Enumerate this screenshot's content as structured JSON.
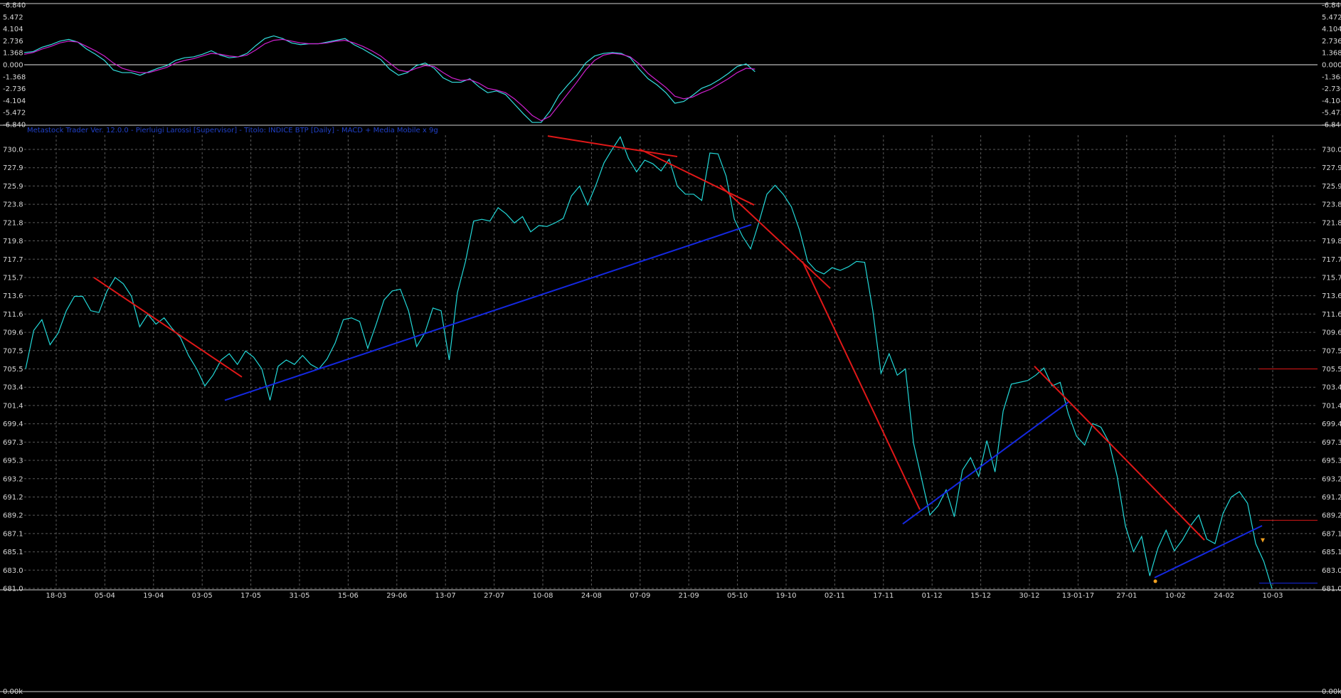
{
  "header": {
    "title": "Metastock Trader   Ver. 12.0.0  -  Pierluigi Larossi  [Supervisor]  -  Titolo: INDICE BTP  [Daily]  -  MACD + Media Mobile x 9g"
  },
  "colors": {
    "background": "#000000",
    "price": "#22d8d8",
    "macd": "#33e0e0",
    "signal": "#d020d0",
    "trend_down": "#e01818",
    "trend_up": "#1428e0",
    "grid": "#5a5a5a",
    "axis_text": "#d8d8d8",
    "highlight_date": "#e02020",
    "marker": "#f0a020"
  },
  "chart_data": [
    {
      "type": "line",
      "panel": "macd",
      "series": [],
      "x": [
        0,
        5,
        10,
        15,
        20,
        25,
        30,
        35,
        40,
        45,
        50,
        55,
        60,
        65,
        70,
        75,
        80,
        85,
        90,
        95,
        100,
        105,
        110,
        115,
        120,
        125,
        130,
        135,
        140,
        145,
        150,
        155,
        160,
        165,
        170,
        175,
        180,
        185,
        190,
        195,
        200,
        205,
        210,
        215,
        220,
        225,
        230,
        235,
        240,
        245,
        250,
        255,
        260,
        265,
        270,
        275,
        280,
        285,
        290,
        295,
        300,
        305,
        310,
        315,
        320,
        325,
        330,
        335,
        340,
        345,
        350,
        355,
        360,
        365,
        370,
        375,
        380,
        385,
        390,
        395,
        400,
        405,
        410,
        415,
        420,
        425,
        430,
        435,
        440,
        445,
        450,
        455,
        460,
        465,
        470,
        475,
        480,
        485,
        490,
        495,
        500,
        505,
        510,
        515,
        520,
        525,
        530,
        535,
        540,
        545,
        550,
        555,
        560,
        565,
        570,
        575,
        580,
        585,
        590,
        595,
        600,
        605,
        610,
        615,
        620,
        625,
        630,
        635,
        640,
        645,
        650,
        655,
        660,
        665,
        670,
        675,
        680,
        685,
        690,
        695,
        700
      ],
      "values": [
        {
          "name": "MACD",
          "y": [
            1.4,
            1.5,
            2.0,
            2.3,
            2.7,
            2.9,
            2.6,
            1.8,
            1.2,
            0.5,
            -0.6,
            -0.9,
            -0.9,
            -1.2,
            -0.8,
            -0.4,
            -0.1,
            0.5,
            0.8,
            0.9,
            1.2,
            1.6,
            1.1,
            0.8,
            0.9,
            1.3,
            2.2,
            3.0,
            3.3,
            3.0,
            2.5,
            2.3,
            2.4,
            2.4,
            2.6,
            2.8,
            3.0,
            2.3,
            1.8,
            1.2,
            0.6,
            -0.5,
            -1.2,
            -0.9,
            -0.1,
            0.2,
            -0.4,
            -1.5,
            -2.0,
            -2.0,
            -1.6,
            -2.5,
            -3.2,
            -3.0,
            -3.4,
            -4.5,
            -5.6,
            -6.6,
            -6.6,
            -5.3,
            -3.5,
            -2.3,
            -1.2,
            0.2,
            1.0,
            1.3,
            1.4,
            1.3,
            0.8,
            -0.5,
            -1.6,
            -2.3,
            -3.2,
            -4.4,
            -4.2,
            -3.5,
            -2.7,
            -2.3,
            -1.7,
            -1.0,
            -0.2,
            0.1,
            -0.8
          ]
        },
        {
          "name": "Media Mobile 9g",
          "y": [
            1.2,
            1.4,
            1.8,
            2.1,
            2.5,
            2.7,
            2.6,
            2.1,
            1.6,
            1.0,
            0.2,
            -0.4,
            -0.7,
            -0.9,
            -0.9,
            -0.6,
            -0.3,
            0.2,
            0.5,
            0.7,
            1.0,
            1.3,
            1.2,
            1.0,
            0.9,
            1.1,
            1.7,
            2.4,
            2.8,
            2.9,
            2.7,
            2.5,
            2.4,
            2.4,
            2.5,
            2.7,
            2.8,
            2.5,
            2.1,
            1.6,
            1.0,
            0.2,
            -0.6,
            -0.8,
            -0.4,
            -0.1,
            -0.2,
            -0.9,
            -1.5,
            -1.8,
            -1.7,
            -2.1,
            -2.7,
            -2.9,
            -3.2,
            -3.9,
            -4.8,
            -5.8,
            -6.4,
            -5.9,
            -4.6,
            -3.3,
            -2.0,
            -0.6,
            0.5,
            1.1,
            1.3,
            1.2,
            0.9,
            0.1,
            -1.0,
            -1.8,
            -2.6,
            -3.6,
            -3.9,
            -3.7,
            -3.2,
            -2.8,
            -2.2,
            -1.6,
            -0.9,
            -0.4,
            -0.5
          ]
        }
      ],
      "ylim": [
        -6.84,
        6.84
      ],
      "yticks": [
        "-6.840",
        "5.472",
        "4.104",
        "2.736",
        "1.368",
        "0.000",
        "-1.368",
        "-2.736",
        "-4.104",
        "-5.472",
        "-6.840"
      ]
    },
    {
      "type": "line",
      "panel": "price",
      "x_ticks": [
        "18-03",
        "05-04",
        "19-04",
        "03-05",
        "17-05",
        "31-05",
        "15-06",
        "29-06",
        "13-07",
        "27-07",
        "10-08",
        "24-08",
        "07-09",
        "21-09",
        "05-10",
        "19-10",
        "02-11",
        "17-11",
        "01-12",
        "15-12",
        "30-12",
        "13-01-17",
        "27-01",
        "10-02",
        "24-02",
        "10-03"
      ],
      "highlight_tick": "13-01-17",
      "yticks": [
        "730.0",
        "727.9",
        "725.9",
        "723.8",
        "721.8",
        "719.8",
        "717.7",
        "715.7",
        "713.6",
        "711.6",
        "709.6",
        "707.5",
        "705.5",
        "703.4",
        "701.4",
        "699.4",
        "697.3",
        "695.3",
        "693.2",
        "691.2",
        "689.2",
        "687.1",
        "685.1",
        "683.0",
        "681.0"
      ],
      "ylim": [
        681.0,
        732.0
      ],
      "series": [
        {
          "name": "INDICE BTP",
          "y": [
            705.5,
            709.8,
            711.0,
            708.2,
            709.5,
            712.0,
            713.6,
            713.6,
            712.0,
            711.8,
            714.2,
            715.7,
            715.0,
            713.6,
            710.2,
            711.6,
            710.5,
            711.2,
            710.0,
            709.0,
            707.0,
            705.5,
            703.6,
            704.8,
            706.5,
            707.2,
            706.0,
            707.5,
            706.8,
            705.5,
            702.0,
            705.8,
            706.5,
            706.0,
            707.0,
            706.0,
            705.5,
            706.6,
            708.4,
            711.0,
            711.2,
            710.8,
            707.8,
            710.4,
            713.2,
            714.2,
            714.4,
            712.0,
            708.0,
            709.5,
            712.3,
            712.0,
            706.5,
            714.0,
            717.5,
            722.0,
            722.2,
            722.0,
            723.5,
            722.8,
            721.8,
            722.5,
            720.8,
            721.5,
            721.4,
            721.8,
            722.3,
            724.8,
            725.9,
            723.8,
            726.0,
            728.5,
            730.0,
            731.4,
            729.0,
            727.5,
            728.8,
            728.4,
            727.6,
            728.9,
            725.9,
            725.0,
            725.0,
            724.3,
            729.6,
            729.5,
            727.0,
            722.2,
            720.3,
            718.9,
            721.8,
            725.0,
            726.0,
            725.0,
            723.6,
            721.0,
            717.5,
            716.5,
            716.1,
            716.8,
            716.5,
            716.9,
            717.5,
            717.4,
            712.0,
            705.0,
            707.2,
            704.8,
            705.5,
            697.2,
            693.2,
            689.2,
            690.2,
            692.0,
            689.0,
            694.2,
            695.6,
            693.5,
            697.5,
            694.0,
            700.8,
            703.8,
            704.0,
            704.2,
            704.8,
            705.6,
            703.6,
            704.0,
            700.5,
            698.0,
            697.0,
            699.4,
            699.0,
            697.3,
            693.5,
            688.0,
            685.1,
            686.8,
            682.4,
            685.5,
            687.5,
            685.2,
            686.4,
            688.0,
            689.2,
            686.5,
            686.0,
            689.4,
            691.2,
            691.8,
            690.5,
            686.0,
            684.0,
            681.0
          ]
        }
      ],
      "trendlines": [
        {
          "color": "red",
          "from": [
            "05-04",
            715.7
          ],
          "to": [
            "17-05",
            704.6
          ]
        },
        {
          "color": "blue",
          "from": [
            "03-05",
            702.0
          ],
          "to": [
            "05-10",
            721.6
          ]
        },
        {
          "color": "red",
          "from": [
            "10-08",
            731.5
          ],
          "to": [
            "21-09",
            729.2
          ]
        },
        {
          "color": "red",
          "from": [
            "07-09",
            730.0
          ],
          "to": [
            "05-10",
            723.8
          ]
        },
        {
          "color": "red",
          "from": [
            "21-09",
            726.0
          ],
          "to": [
            "02-11",
            714.5
          ]
        },
        {
          "color": "red",
          "from": [
            "19-10",
            717.5
          ],
          "to": [
            "01-12",
            689.8
          ]
        },
        {
          "color": "blue",
          "from": [
            "17-11",
            688.2
          ],
          "to": [
            "30-12",
            701.8
          ]
        },
        {
          "color": "red",
          "from": [
            "30-12",
            705.8
          ],
          "to": [
            "24-02",
            686.4
          ]
        },
        {
          "color": "blue",
          "from": [
            "10-02",
            682.2
          ],
          "to": [
            "10-03",
            688.0
          ]
        },
        {
          "color": "red",
          "from": [
            "10-03",
            705.5
          ],
          "to": [
            "10-03",
            705.5
          ]
        },
        {
          "color": "red",
          "from": [
            "10-03",
            688.6
          ],
          "to": [
            "10-03",
            688.6
          ]
        },
        {
          "color": "blue",
          "from": [
            "10-03",
            681.6
          ],
          "to": [
            "10-03",
            681.6
          ]
        }
      ]
    },
    {
      "type": "bar",
      "panel": "volume",
      "yticks": [
        "0.00k"
      ],
      "values": []
    }
  ]
}
